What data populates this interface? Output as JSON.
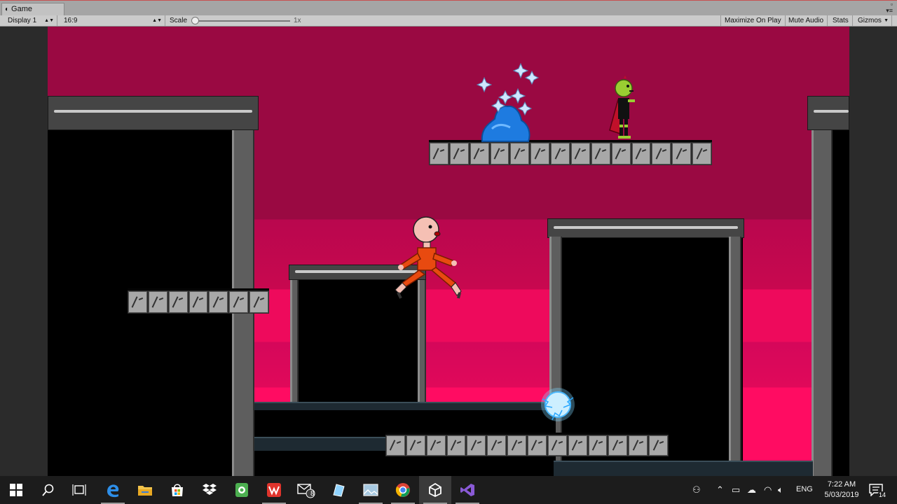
{
  "window": {
    "tab_title": "Game",
    "tab_icon": "game-view-icon"
  },
  "toolbar": {
    "display": "Display 1",
    "aspect": "16:9",
    "scale_label": "Scale",
    "scale_value": "1x",
    "maximize_on_play": "Maximize On Play",
    "mute_audio": "Mute Audio",
    "stats": "Stats",
    "gizmos": "Gizmos",
    "scale_slider_level": 0.0
  },
  "scene": {
    "sky_color": "#9a0942",
    "accent_colors": [
      "#ee0a5c",
      "#ff0c62"
    ],
    "player": {
      "name_icon": "bald-orange-runner-sprite"
    },
    "enemy": {
      "name_icon": "green-headed-caped-goblin-sprite"
    },
    "pickup": {
      "name_icon": "blue-slime-sparkles-sprite"
    },
    "orb": {
      "name_icon": "electric-blue-orb-sprite"
    }
  },
  "taskbar": {
    "apps": [
      {
        "name": "windows-start",
        "running": false
      },
      {
        "name": "search",
        "running": false
      },
      {
        "name": "task-view",
        "running": false
      },
      {
        "name": "edge",
        "running": true
      },
      {
        "name": "file-explorer",
        "running": false
      },
      {
        "name": "store",
        "running": false
      },
      {
        "name": "dropbox",
        "running": false
      },
      {
        "name": "evernote",
        "running": false
      },
      {
        "name": "wps-office",
        "running": true
      },
      {
        "name": "mail",
        "running": false
      },
      {
        "name": "notepad-app",
        "running": false
      },
      {
        "name": "photos",
        "running": true
      },
      {
        "name": "chrome",
        "running": true
      },
      {
        "name": "unity",
        "running": true
      },
      {
        "name": "visual-studio",
        "running": true
      }
    ],
    "mail_badge": "8",
    "language": "ENG",
    "time": "7:22 AM",
    "date": "5/03/2019",
    "notification_count": "14"
  }
}
